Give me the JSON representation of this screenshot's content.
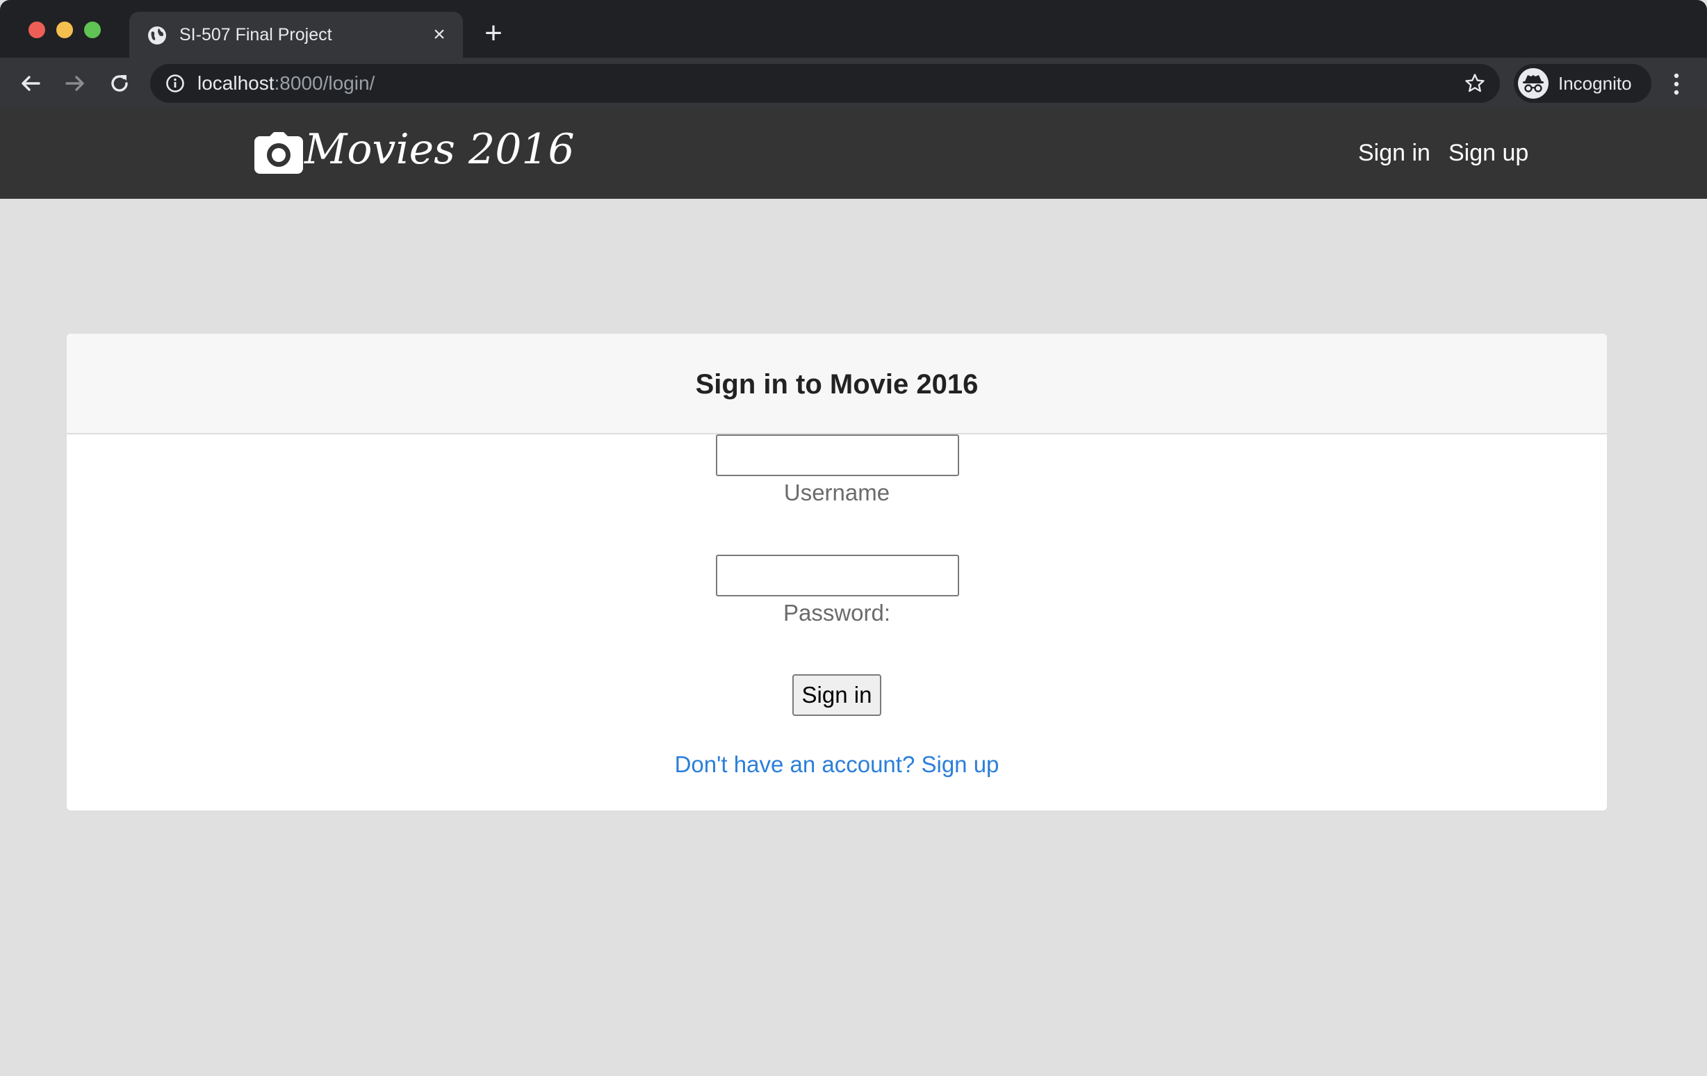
{
  "browser": {
    "tab": {
      "title": "SI-507 Final Project",
      "close_glyph": "×"
    },
    "new_tab_glyph": "+",
    "address": {
      "host": "localhost",
      "path": ":8000/login/"
    },
    "profile": {
      "label": "Incognito"
    }
  },
  "site": {
    "brand": "Movies 2016",
    "nav": {
      "signin": "Sign in",
      "signup": "Sign up"
    }
  },
  "login": {
    "title": "Sign in to Movie 2016",
    "username": {
      "label": "Username",
      "value": ""
    },
    "password": {
      "label": "Password:",
      "value": ""
    },
    "submit": "Sign in",
    "signup_link": "Don't have an account? Sign up"
  }
}
